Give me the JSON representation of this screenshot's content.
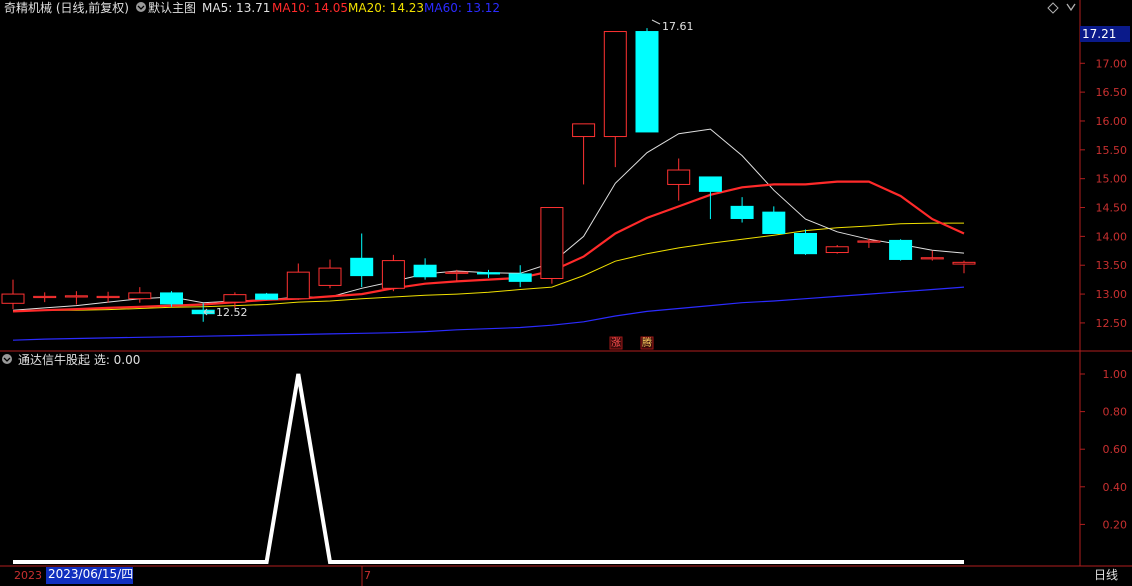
{
  "main_panel": {
    "stock_label": "奇精机械 (日线,前复权)",
    "template_label": "默认主图",
    "ma_labels": [
      {
        "text": "MA5: 13.71",
        "color": "#e0e0e0"
      },
      {
        "text": "MA10: 14.05",
        "color": "#ff2a2a"
      },
      {
        "text": "MA20: 14.23",
        "color": "#f0e000"
      },
      {
        "text": "MA60: 13.12",
        "color": "#2b2bff"
      }
    ],
    "price_box": "17.21",
    "high_label": "17.61",
    "low_label": "12.52",
    "mark_labels": [
      "涨",
      "腾"
    ]
  },
  "sub_panel": {
    "indicator_label": "通达信牛股起 选: 0.00"
  },
  "bottom_bar": {
    "year_label": "2023",
    "date_label": "2023/06/15/四",
    "month_label": "7",
    "period_label": "日线"
  },
  "chart_data": [
    {
      "type": "candlestick",
      "title": "奇精机械 (日线,前复权)",
      "ylim": [
        12.1,
        17.75
      ],
      "y_ticks": [
        12.5,
        13.0,
        13.5,
        14.0,
        14.5,
        15.0,
        15.5,
        16.0,
        16.5,
        17.0,
        17.5
      ],
      "candles": [
        {
          "o": 12.84,
          "h": 13.25,
          "l": 12.74,
          "c": 13.0
        },
        {
          "o": 12.94,
          "h": 13.03,
          "l": 12.86,
          "c": 12.96
        },
        {
          "o": 12.96,
          "h": 13.05,
          "l": 12.82,
          "c": 12.97
        },
        {
          "o": 12.95,
          "h": 13.04,
          "l": 12.85,
          "c": 12.96
        },
        {
          "o": 12.92,
          "h": 13.12,
          "l": 12.85,
          "c": 13.02
        },
        {
          "o": 13.02,
          "h": 13.05,
          "l": 12.78,
          "c": 12.83
        },
        {
          "o": 12.72,
          "h": 12.84,
          "l": 12.52,
          "c": 12.66
        },
        {
          "o": 12.86,
          "h": 13.03,
          "l": 12.76,
          "c": 12.99
        },
        {
          "o": 13.0,
          "h": 13.02,
          "l": 12.9,
          "c": 12.91
        },
        {
          "o": 12.92,
          "h": 13.53,
          "l": 12.9,
          "c": 13.38
        },
        {
          "o": 13.15,
          "h": 13.6,
          "l": 13.1,
          "c": 13.45
        },
        {
          "o": 13.62,
          "h": 14.05,
          "l": 13.12,
          "c": 13.32
        },
        {
          "o": 13.1,
          "h": 13.68,
          "l": 13.05,
          "c": 13.58
        },
        {
          "o": 13.5,
          "h": 13.62,
          "l": 13.25,
          "c": 13.3
        },
        {
          "o": 13.36,
          "h": 13.42,
          "l": 13.22,
          "c": 13.38
        },
        {
          "o": 13.37,
          "h": 13.42,
          "l": 13.28,
          "c": 13.35
        },
        {
          "o": 13.35,
          "h": 13.5,
          "l": 13.12,
          "c": 13.22
        },
        {
          "o": 13.27,
          "h": 14.5,
          "l": 13.18,
          "c": 14.5
        },
        {
          "o": 15.73,
          "h": 15.95,
          "l": 14.9,
          "c": 15.95
        },
        {
          "o": 15.73,
          "h": 17.55,
          "l": 15.2,
          "c": 17.55
        },
        {
          "o": 17.55,
          "h": 17.61,
          "l": 15.81,
          "c": 15.81
        },
        {
          "o": 14.9,
          "h": 15.35,
          "l": 14.62,
          "c": 15.15
        },
        {
          "o": 15.03,
          "h": 15.03,
          "l": 14.3,
          "c": 14.78
        },
        {
          "o": 14.52,
          "h": 14.68,
          "l": 14.24,
          "c": 14.31
        },
        {
          "o": 14.42,
          "h": 14.52,
          "l": 14.05,
          "c": 14.05
        },
        {
          "o": 14.05,
          "h": 14.12,
          "l": 13.68,
          "c": 13.7
        },
        {
          "o": 13.72,
          "h": 13.85,
          "l": 13.7,
          "c": 13.82
        },
        {
          "o": 13.9,
          "h": 13.96,
          "l": 13.8,
          "c": 13.92
        },
        {
          "o": 13.93,
          "h": 13.95,
          "l": 13.58,
          "c": 13.6
        },
        {
          "o": 13.63,
          "h": 13.75,
          "l": 13.58,
          "c": 13.63
        },
        {
          "o": 13.52,
          "h": 13.58,
          "l": 13.36,
          "c": 13.55
        }
      ],
      "series": [
        {
          "name": "MA5",
          "color": "#e0e0e0",
          "values": [
            12.72,
            12.76,
            12.8,
            12.86,
            12.92,
            12.95,
            12.85,
            12.88,
            12.9,
            12.95,
            12.95,
            13.1,
            13.22,
            13.35,
            13.4,
            13.37,
            13.36,
            13.54,
            14.0,
            14.92,
            15.45,
            15.78,
            15.86,
            15.4,
            14.8,
            14.3,
            14.08,
            13.95,
            13.86,
            13.76,
            13.71
          ]
        },
        {
          "name": "MA10",
          "color": "#ff2a2a",
          "values": [
            12.7,
            12.72,
            12.74,
            12.76,
            12.78,
            12.8,
            12.82,
            12.86,
            12.9,
            12.92,
            12.96,
            13.0,
            13.1,
            13.18,
            13.22,
            13.25,
            13.28,
            13.4,
            13.65,
            14.05,
            14.32,
            14.52,
            14.72,
            14.85,
            14.9,
            14.9,
            14.95,
            14.95,
            14.7,
            14.3,
            14.05
          ]
        },
        {
          "name": "MA20",
          "color": "#f0e000",
          "values": [
            12.7,
            12.72,
            12.72,
            12.73,
            12.75,
            12.77,
            12.78,
            12.8,
            12.82,
            12.86,
            12.88,
            12.92,
            12.95,
            12.98,
            13.0,
            13.03,
            13.08,
            13.12,
            13.32,
            13.57,
            13.7,
            13.8,
            13.88,
            13.95,
            14.02,
            14.1,
            14.15,
            14.18,
            14.22,
            14.23,
            14.23
          ]
        },
        {
          "name": "MA60",
          "color": "#2b2bff",
          "values": [
            12.2,
            12.22,
            12.23,
            12.24,
            12.25,
            12.26,
            12.27,
            12.28,
            12.29,
            12.3,
            12.31,
            12.32,
            12.33,
            12.35,
            12.38,
            12.4,
            12.42,
            12.46,
            12.52,
            12.62,
            12.7,
            12.75,
            12.8,
            12.85,
            12.88,
            12.92,
            12.96,
            13.0,
            13.04,
            13.08,
            13.12
          ]
        }
      ]
    },
    {
      "type": "line",
      "title": "通达信牛股起",
      "ylim": [
        0.0,
        1.0
      ],
      "y_ticks": [
        0.2,
        0.4,
        0.6,
        0.8,
        1.0
      ],
      "series": [
        {
          "name": "选",
          "color": "#ffffff",
          "values": [
            0,
            0,
            0,
            0,
            0,
            0,
            0,
            0,
            0,
            1,
            0,
            0,
            0,
            0,
            0,
            0,
            0,
            0,
            0,
            0,
            0,
            0,
            0,
            0,
            0,
            0,
            0,
            0,
            0,
            0,
            0
          ]
        }
      ]
    }
  ]
}
